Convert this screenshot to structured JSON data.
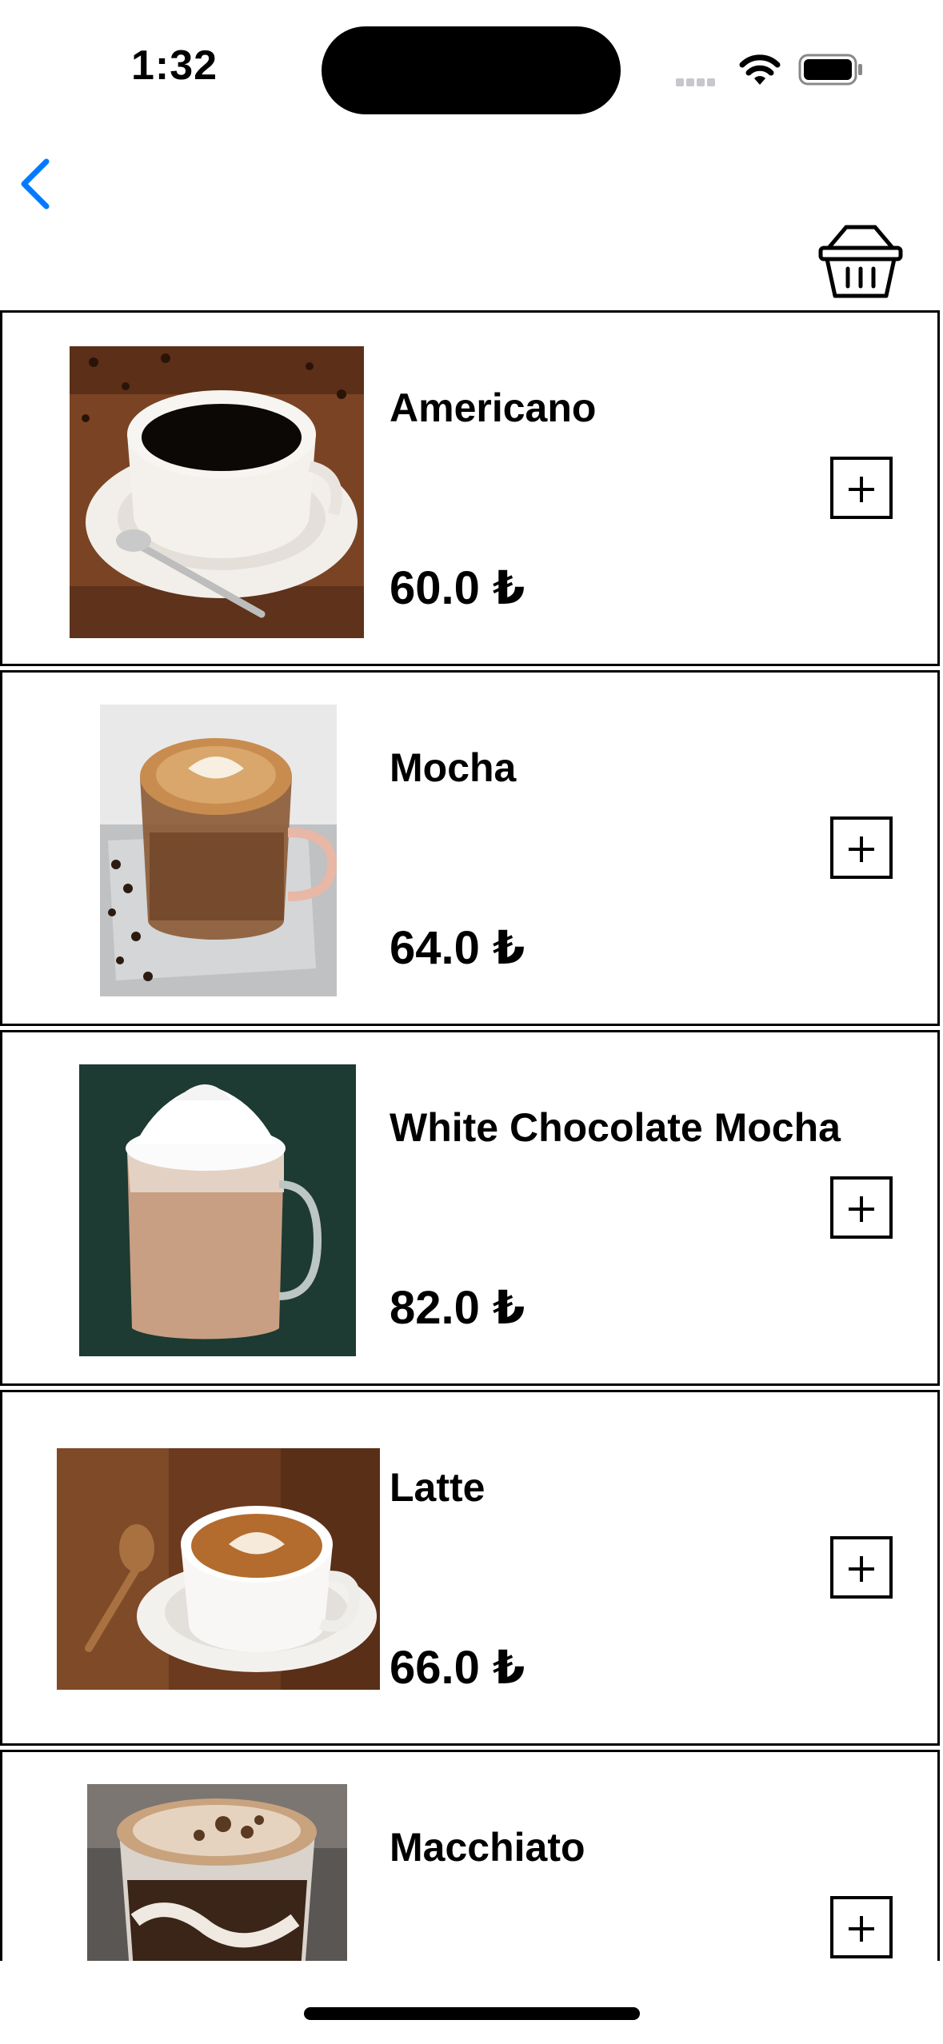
{
  "status_bar": {
    "time": "1:32"
  },
  "nav": {
    "back_icon": "chevron-left-icon",
    "cart_icon": "basket-icon",
    "accent_color": "#007aff"
  },
  "products": [
    {
      "name": "Americano",
      "price": "60.0 ₺"
    },
    {
      "name": "Mocha",
      "price": "64.0 ₺"
    },
    {
      "name": "White Chocolate Mocha",
      "price": "82.0 ₺"
    },
    {
      "name": "Latte",
      "price": "66.0 ₺"
    },
    {
      "name": "Macchiato",
      "price": ""
    }
  ],
  "add_icon": "plus-square-icon"
}
